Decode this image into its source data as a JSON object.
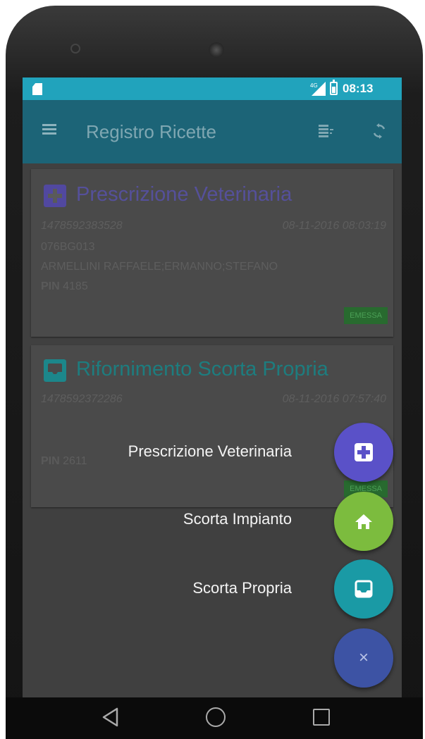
{
  "statusbar": {
    "time": "08:13",
    "network": "4G"
  },
  "appbar": {
    "title": "Registro Ricette"
  },
  "cards": [
    {
      "title": "Prescrizione Veterinaria",
      "id": "1478592383528",
      "date": "08-11-2016 08:03:19",
      "code": "076BG013",
      "names": "ARMELLINI RAFFAELE;ERMANNO;STEFANO",
      "pin_label": "PIN",
      "pin_value": "4185",
      "status": "EMESSA",
      "icon": "plus-square-icon",
      "color": "#5148a0"
    },
    {
      "title": "Rifornimento Scorta Propria",
      "id": "1478592372286",
      "date": "08-11-2016 07:57:40",
      "pin_label": "PIN",
      "pin_value": "2611",
      "status": "EMESSA",
      "icon": "inbox-icon",
      "color": "#1c878b"
    }
  ],
  "fab_menu": [
    {
      "label": "Prescrizione Veterinaria",
      "icon": "plus-square-icon",
      "color": "#5a51c8"
    },
    {
      "label": "Scorta Impianto",
      "icon": "home-icon",
      "color": "#7cbc3e"
    },
    {
      "label": "Scorta Propria",
      "icon": "inbox-icon",
      "color": "#1a9aa5"
    }
  ],
  "fab_close": {
    "icon": "close-icon",
    "symbol": "×",
    "color": "#3d53a4"
  },
  "navbar": {
    "back": "back-icon",
    "home": "home-circle-icon",
    "recents": "recents-icon"
  }
}
